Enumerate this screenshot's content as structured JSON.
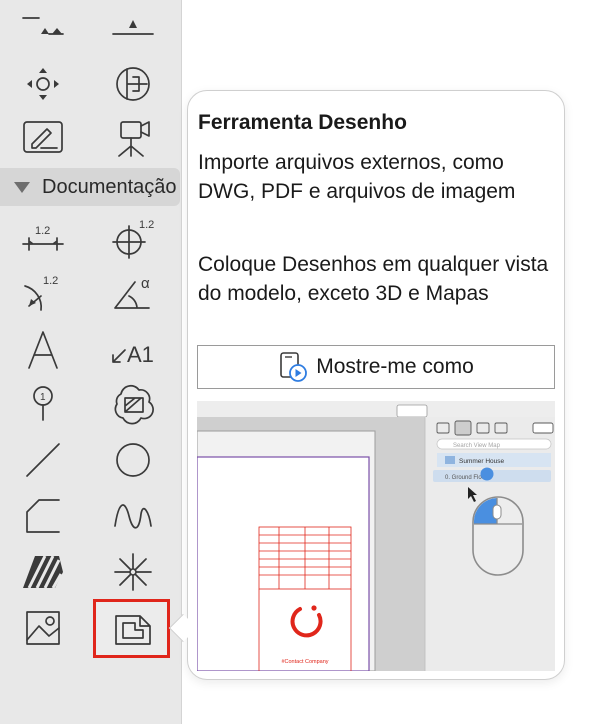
{
  "toolbox": {
    "section_label": "Documentação",
    "tools": [
      {
        "name": "level-dimension-tool",
        "icon": "level-dimension-icon"
      },
      {
        "name": "elevation-dimension-tool",
        "icon": "elevation-dimension-icon"
      },
      {
        "name": "navigation-tool",
        "icon": "navigation-icon"
      },
      {
        "name": "section-tool",
        "icon": "section-icon"
      },
      {
        "name": "edit-label-tool",
        "icon": "pencil-icon"
      },
      {
        "name": "camera-tool",
        "icon": "camera-icon"
      },
      {
        "name": "dimension-tool",
        "icon": "linear-dimension-icon",
        "label": "1.2"
      },
      {
        "name": "radial-dimension-tool",
        "icon": "radial-dimension-icon",
        "label": "1.2"
      },
      {
        "name": "arc-dimension-tool",
        "icon": "arc-dimension-icon",
        "label": "1.2"
      },
      {
        "name": "angle-dimension-tool",
        "icon": "angle-dimension-icon",
        "label": "α"
      },
      {
        "name": "text-tool",
        "icon": "text-icon",
        "label": "A"
      },
      {
        "name": "label-tool",
        "icon": "label-icon",
        "label": "A1"
      },
      {
        "name": "marker-tool",
        "icon": "marker-icon",
        "label": "1"
      },
      {
        "name": "fill-tool",
        "icon": "fill-icon"
      },
      {
        "name": "line-tool",
        "icon": "line-icon"
      },
      {
        "name": "circle-tool",
        "icon": "circle-icon"
      },
      {
        "name": "polyline-tool",
        "icon": "polyline-icon"
      },
      {
        "name": "spline-tool",
        "icon": "spline-icon"
      },
      {
        "name": "hatch-tool",
        "icon": "hatch-icon"
      },
      {
        "name": "hotspot-tool",
        "icon": "hotspot-icon"
      },
      {
        "name": "image-tool",
        "icon": "image-icon"
      },
      {
        "name": "drawing-tool",
        "icon": "drawing-icon",
        "selected": true
      }
    ]
  },
  "tooltip": {
    "title": "Ferramenta Desenho",
    "description_1": "Importe arquivos externos, como DWG, PDF e arquivos de imagem",
    "description_2": "Coloque Desenhos em qualquer vista do modelo, exceto 3D e Mapas",
    "button_label": "Mostre-me como",
    "button_icon": "video-tutorial-icon",
    "preview": {
      "search_placeholder": "Search View Map",
      "tree_item": "Summer House",
      "tree_child": "0. Ground Floor",
      "logo_caption": "#Contact Company",
      "highlight_color": "#e0261b"
    }
  },
  "colors": {
    "selection": "#e0261b",
    "toolbox_bg": "#e8e8e8",
    "icon": "#3a3a3a",
    "preview_blue": "#4a8fe0"
  }
}
